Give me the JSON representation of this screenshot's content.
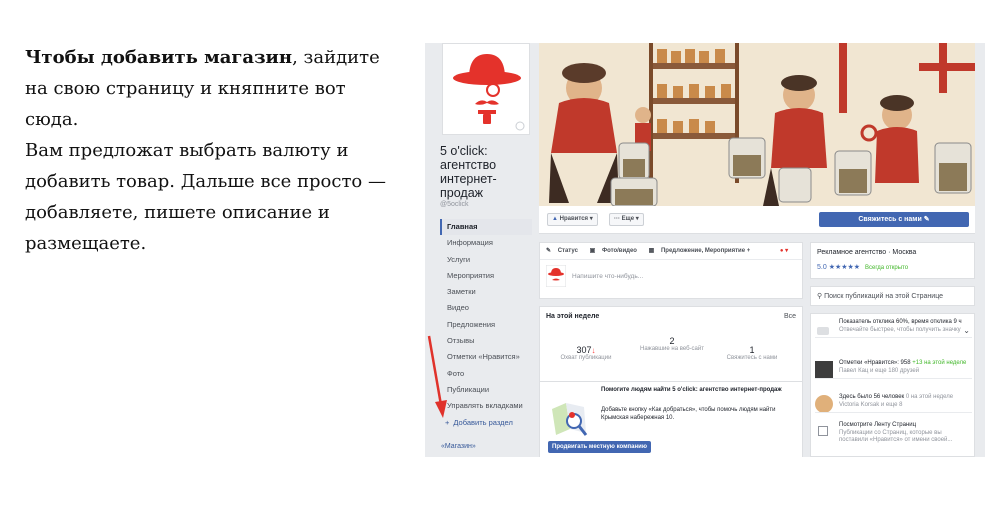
{
  "article": {
    "bold": "Чтобы добавить магазин",
    "line1_rest": ", зайдите",
    "line2": "на свою страницу и княпните вот",
    "line3": "сюда.",
    "line4": "Вам предложат выбрать валюту и",
    "line5": "добавить товар. Дальше все просто —",
    "line6": "добавляете, пишете описание и",
    "line7": "размещаете."
  },
  "page": {
    "name": "5 o'click: агентство интернет-продаж",
    "handle": "@5oclick"
  },
  "nav": {
    "items": [
      {
        "label": "Главная"
      },
      {
        "label": "Информация"
      },
      {
        "label": "Услуги"
      },
      {
        "label": "Мероприятия"
      },
      {
        "label": "Заметки"
      },
      {
        "label": "Видео"
      },
      {
        "label": "Предложения"
      },
      {
        "label": "Отзывы"
      },
      {
        "label": "Отметки «Нравится»"
      },
      {
        "label": "Фото"
      },
      {
        "label": "Публикации"
      },
      {
        "label": "Управлять вкладками"
      }
    ],
    "add_section": "Добавить раздел",
    "shop": "«Магазин»"
  },
  "actions": {
    "like": "Нравится",
    "more": "Еще",
    "contact": "Свяжитесь с нами"
  },
  "composer": {
    "status": "Статус",
    "photo": "Фото/видео",
    "offer": "Предложение, Мероприятие +",
    "placeholder": "Напишите что-нибудь..."
  },
  "week": {
    "title": "На этой неделе",
    "all": "Все",
    "stats": [
      {
        "value": "307",
        "label": "Охват публикации"
      },
      {
        "value": "2",
        "label": "Нажавшие на веб-сайт"
      },
      {
        "value": "1",
        "label": "Свяжитесь с нами"
      }
    ]
  },
  "promo": {
    "title": "Помогите людям найти 5 o'click: агентство интернет-продаж",
    "text": "Добавьте кнопку «Как добраться», чтобы помочь людям найти Крымская набережная 10.",
    "button": "Продвигать местную компанию"
  },
  "about": {
    "category": "Рекламное агентство · Москва",
    "rating": "5.0",
    "stars": "★★★★★",
    "open": "Всегда открыто"
  },
  "search": {
    "placeholder": "Поиск публикаций на этой Странице"
  },
  "insights": {
    "r1": "Показатель отклика 60%, время отклика 9 ч",
    "r1b": "Отвечайте быстрее, чтобы получить значку",
    "r2a": "Отметки «Нравится»: 958",
    "r2b": "+13 на этой неделе",
    "r2c": "Павел Кац и еще 180 друзей",
    "r3a": "Здесь было 56 человек",
    "r3b": "0 на этой неделе",
    "r3c": "Victoria Korsak и еще 8",
    "r4a": "Посмотрите Ленту Страниц",
    "r4b": "Публикации со Страниц, которые вы поставили «Нравится» от имени своей..."
  },
  "colors": {
    "fb_blue": "#4267b2",
    "link": "#365899",
    "arrow_red": "#e0322b"
  }
}
